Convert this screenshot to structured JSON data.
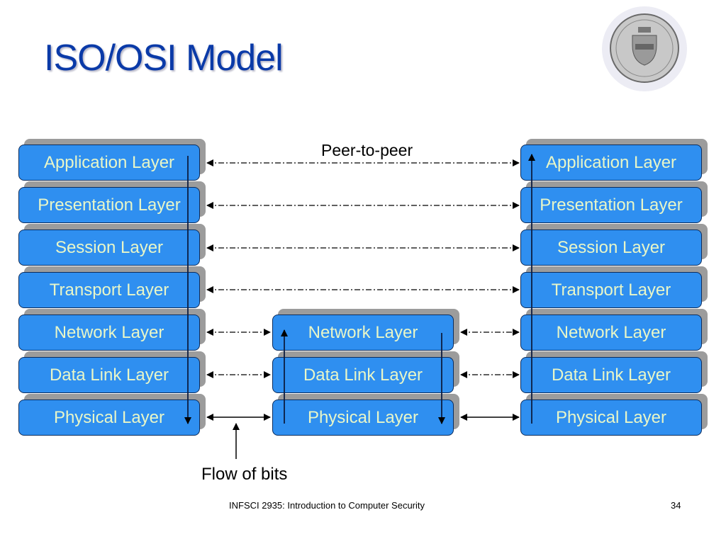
{
  "slide": {
    "title": "ISO/OSI Model",
    "logo": "university-of-pittsburgh-seal",
    "footer_text": "INFSCI 2935: Introduction to Computer Security",
    "page_number": "34"
  },
  "diagram": {
    "left_stack": [
      "Application Layer",
      "Presentation Layer",
      "Session Layer",
      "Transport Layer",
      "Network Layer",
      "Data Link Layer",
      "Physical Layer"
    ],
    "middle_stack": [
      "Network Layer",
      "Data Link Layer",
      "Physical Layer"
    ],
    "right_stack": [
      "Application Layer",
      "Presentation Layer",
      "Session Layer",
      "Transport Layer",
      "Network Layer",
      "Data Link Layer",
      "Physical Layer"
    ],
    "peer_label": "Peer-to-peer",
    "flow_label": "Flow of bits",
    "colors": {
      "title": "#0a3aa8",
      "box_fill": "#2f8ff0",
      "box_text": "#e8f6c8",
      "box_shadow": "#9c9c9c",
      "box_border": "#0c2c5c"
    }
  }
}
